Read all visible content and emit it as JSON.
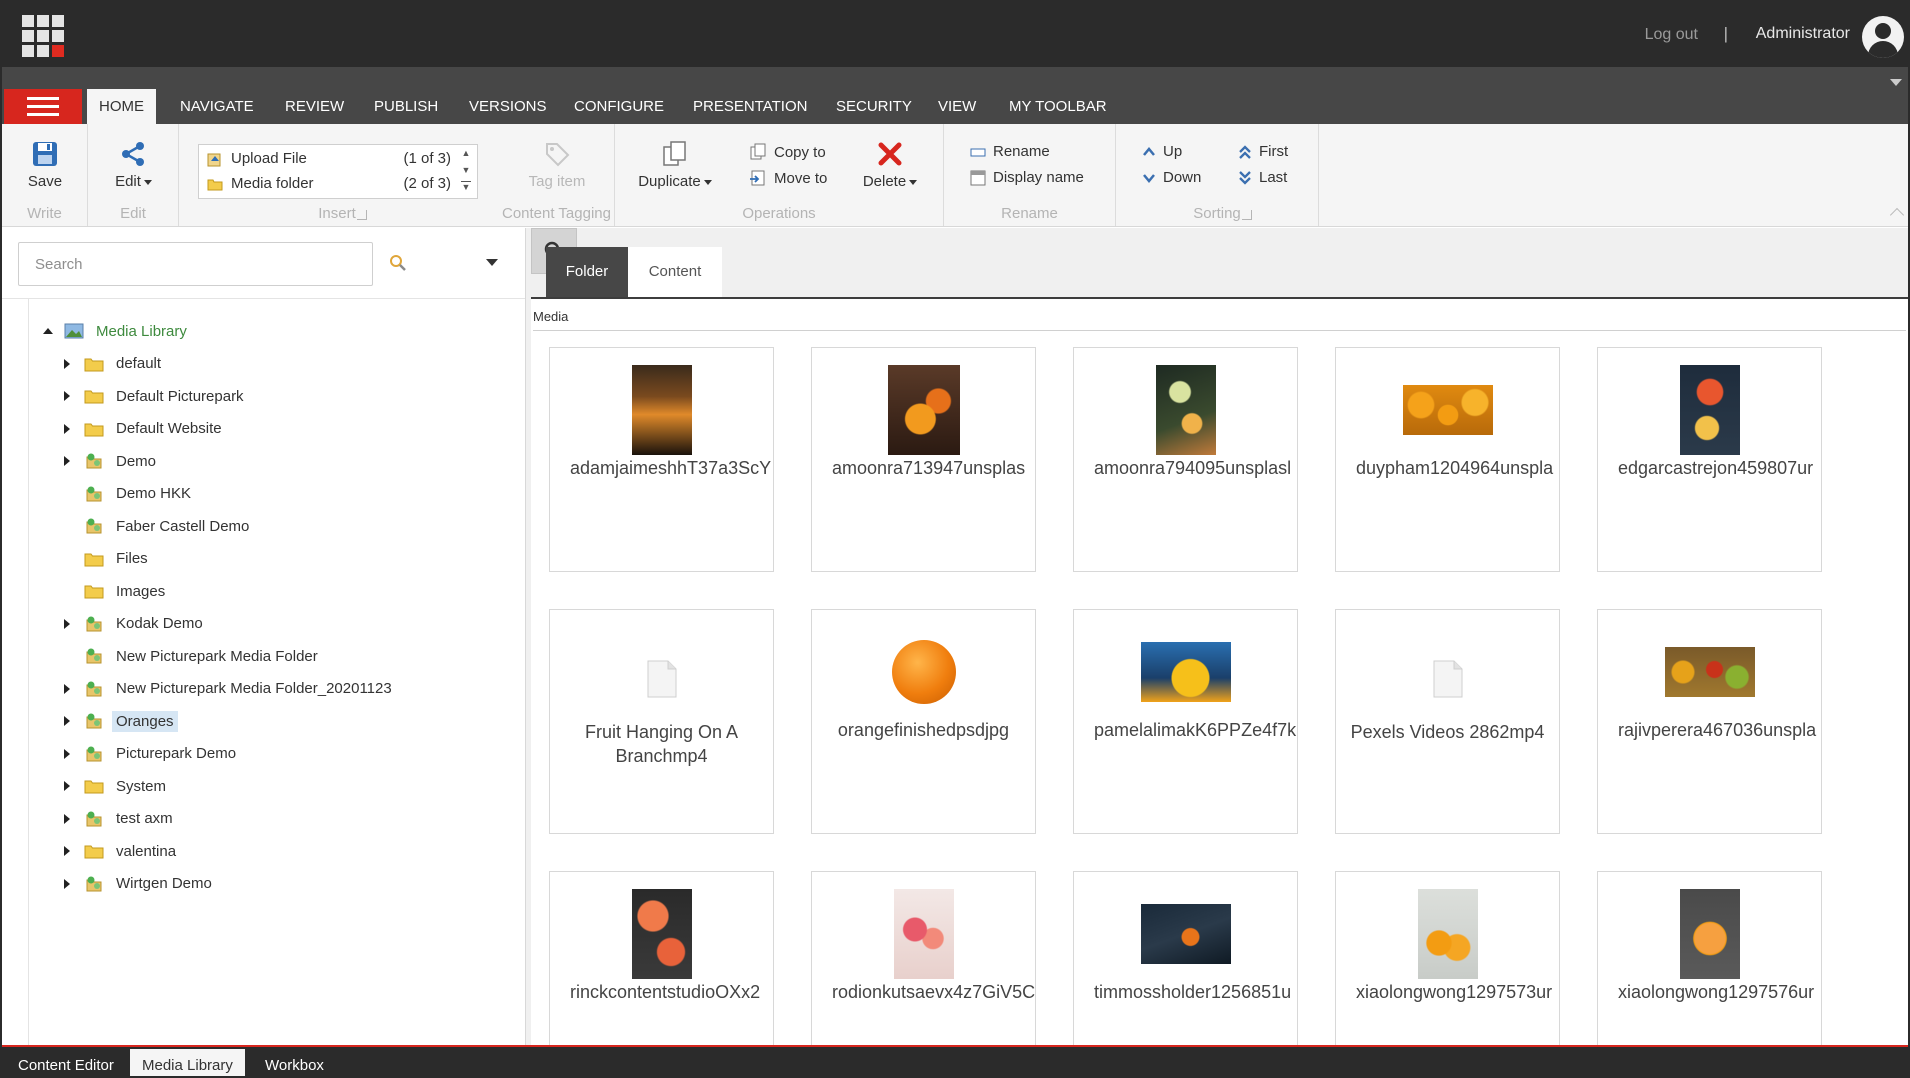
{
  "topbar": {
    "logout_label": "Log out",
    "divider": "|",
    "username": "Administrator"
  },
  "ribbon_tabs": [
    "HOME",
    "NAVIGATE",
    "REVIEW",
    "PUBLISH",
    "VERSIONS",
    "CONFIGURE",
    "PRESENTATION",
    "SECURITY",
    "VIEW",
    "MY TOOLBAR"
  ],
  "ribbon": {
    "write": {
      "save": "Save",
      "label": "Write"
    },
    "edit": {
      "edit": "Edit",
      "label": "Edit"
    },
    "insert": {
      "items": [
        {
          "label": "Upload File",
          "count": "(1 of 3)"
        },
        {
          "label": "Media folder",
          "count": "(2 of 3)"
        }
      ],
      "label": "Insert"
    },
    "tagging": {
      "tag_item": "Tag item",
      "label": "Content Tagging"
    },
    "operations": {
      "duplicate": "Duplicate",
      "copy_to": "Copy to",
      "move_to": "Move to",
      "delete": "Delete",
      "label": "Operations"
    },
    "rename": {
      "rename": "Rename",
      "display_name": "Display name",
      "label": "Rename"
    },
    "sorting": {
      "up": "Up",
      "down": "Down",
      "first": "First",
      "last": "Last",
      "label": "Sorting"
    }
  },
  "search": {
    "placeholder": "Search"
  },
  "tree": {
    "root": "Media Library",
    "items": [
      {
        "label": "default",
        "type": "folder",
        "expandable": true
      },
      {
        "label": "Default Picturepark",
        "type": "folder",
        "expandable": true
      },
      {
        "label": "Default Website",
        "type": "folder",
        "expandable": true
      },
      {
        "label": "Demo",
        "type": "picturepark",
        "expandable": true
      },
      {
        "label": "Demo HKK",
        "type": "picturepark",
        "expandable": false
      },
      {
        "label": "Faber Castell Demo",
        "type": "picturepark",
        "expandable": false
      },
      {
        "label": "Files",
        "type": "folder",
        "expandable": false
      },
      {
        "label": "Images",
        "type": "folder",
        "expandable": false
      },
      {
        "label": "Kodak Demo",
        "type": "picturepark",
        "expandable": true
      },
      {
        "label": "New Picturepark Media Folder",
        "type": "picturepark",
        "expandable": false
      },
      {
        "label": "New Picturepark Media Folder_20201123",
        "type": "picturepark",
        "expandable": true
      },
      {
        "label": "Oranges",
        "type": "picturepark",
        "expandable": true,
        "selected": true
      },
      {
        "label": "Picturepark Demo",
        "type": "picturepark",
        "expandable": true
      },
      {
        "label": "System",
        "type": "folder",
        "expandable": true
      },
      {
        "label": "test axm",
        "type": "picturepark",
        "expandable": true
      },
      {
        "label": "valentina",
        "type": "folder",
        "expandable": true
      },
      {
        "label": "Wirtgen Demo",
        "type": "picturepark",
        "expandable": true
      }
    ]
  },
  "right": {
    "tabs": {
      "folder": "Folder",
      "content": "Content"
    },
    "breadcrumb": "Media"
  },
  "tiles": [
    {
      "name": "adamjaimeshhT37a3ScY",
      "thumb": "cocktail"
    },
    {
      "name": "amoonra713947unsplas",
      "thumb": "fruit-bowl"
    },
    {
      "name": "amoonra794095unsplasl",
      "thumb": "veg-slices"
    },
    {
      "name": "duypham1204964unspla",
      "thumb": "orange-pile"
    },
    {
      "name": "edgarcastrejon459807ur",
      "thumb": "citrus-board"
    },
    {
      "name": "Fruit Hanging On A Branchmp4",
      "thumb": "file"
    },
    {
      "name": "orangefinishedpsdjpg",
      "thumb": "orange"
    },
    {
      "name": "pamelalimakK6PPZe4f7k",
      "thumb": "juice"
    },
    {
      "name": "Pexels Videos 2862mp4",
      "thumb": "file"
    },
    {
      "name": "rajivperera467036unspla",
      "thumb": "market"
    },
    {
      "name": "rinckcontentstudioOXx2",
      "thumb": "grapefruit"
    },
    {
      "name": "rodionkutsaevx4z7GiV5C",
      "thumb": "drinks"
    },
    {
      "name": "timmossholder1256851u",
      "thumb": "dark-orange"
    },
    {
      "name": "xiaolongwong1297573ur",
      "thumb": "oranges-grey"
    },
    {
      "name": "xiaolongwong1297576ur",
      "thumb": "orange-half"
    }
  ],
  "bottom_tabs": [
    "Content Editor",
    "Media Library",
    "Workbox"
  ],
  "colors": {
    "brand_red": "#d7261e",
    "dark": "#2b2b2b",
    "tab_bar": "#474747",
    "selected": "#d6e6f4",
    "root_text": "#3e8a3e"
  },
  "icons": {
    "app": "app-grid-icon",
    "save": "floppy-disk-icon",
    "edit": "share-edit-icon",
    "tag": "tag-icon",
    "duplicate": "duplicate-pages-icon",
    "delete": "red-x-icon",
    "search": "magnifier-icon"
  }
}
